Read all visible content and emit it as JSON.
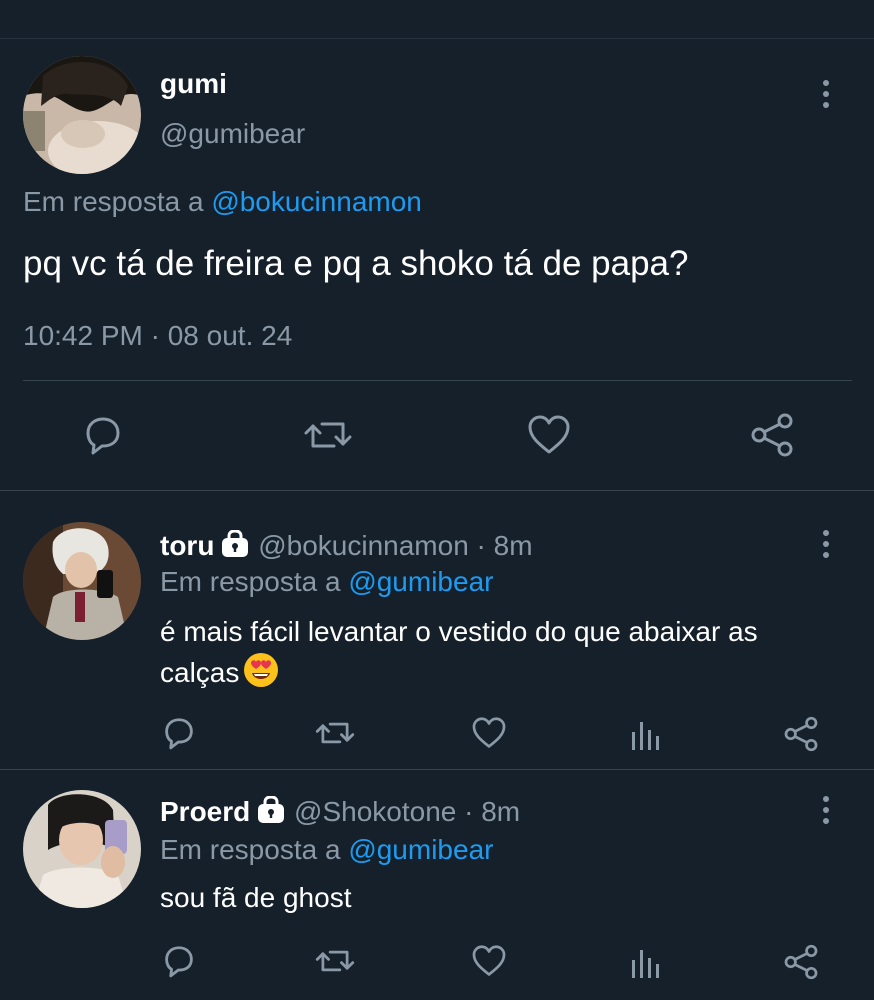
{
  "main_tweet": {
    "display_name": "gumi",
    "handle": "@gumibear",
    "reply_prefix": "Em resposta a",
    "reply_to": "@bokucinnamon",
    "text": "pq vc tá de freira e pq a shoko tá de papa?",
    "timestamp": "10:42 PM · 08 out. 24",
    "actions": [
      "reply-icon",
      "retweet-icon",
      "like-icon",
      "share-icon"
    ]
  },
  "replies": [
    {
      "display_name": "toru",
      "handle": "@bokucinnamon",
      "time": "· 8m",
      "reply_prefix": "Em resposta a",
      "reply_to": "@gumibear",
      "text_line1": "é mais fácil levantar o vestido do que abaixar as",
      "text_line2": "calças",
      "emoji": "heart-eyes-emoji",
      "locked": true,
      "actions": [
        "reply-icon",
        "retweet-icon",
        "like-icon",
        "stats-icon",
        "share-icon"
      ]
    },
    {
      "display_name": "Proerd",
      "handle": "@Shokotone",
      "time": "· 8m",
      "reply_prefix": "Em resposta a",
      "reply_to": "@gumibear",
      "text_line1": "sou fã de ghost",
      "locked": true,
      "actions": [
        "reply-icon",
        "retweet-icon",
        "like-icon",
        "stats-icon",
        "share-icon"
      ]
    }
  ],
  "colors": {
    "background": "#15202b",
    "muted": "#8b98a5",
    "link": "#1d9bf0",
    "divider": "#38444d"
  }
}
